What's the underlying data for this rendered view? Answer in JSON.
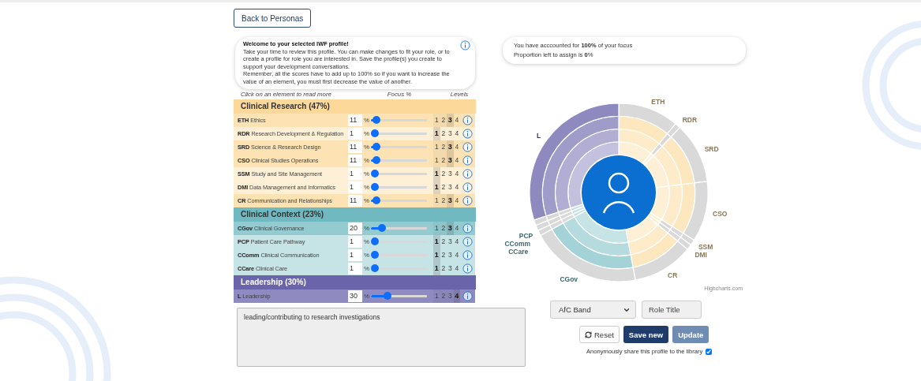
{
  "back_button": "Back to Personas",
  "intro": {
    "title": "Welcome to your selected IWF profile!",
    "paragraphs": [
      "Take your time to review this profile. You can make changes to fit your role, or to create a profile for role you are interested in. Save the profile(s) you create to support your development conversations.",
      "Remember, all the scores have to add up to 100% so if you want to increase the value of an element, you must first decrease the value of another."
    ]
  },
  "table_headers": [
    "Click on an element to read more",
    "Focus %",
    "Levels"
  ],
  "groups": [
    {
      "title": "Clinical Research (47%)",
      "color": "#fcd99a",
      "rows": [
        {
          "label": "**ETH** Ethics",
          "focus": "11",
          "unit": "%",
          "level": 0.1,
          "levels": [
            {
              "label": "1",
              "selected": false
            },
            {
              "label": "2",
              "selected": false
            },
            {
              "label": "3",
              "selected": true
            },
            {
              "label": "4",
              "selected": false
            }
          ]
        },
        {
          "label": "**RDR** Research Development & Regulation",
          "focus": "1",
          "unit": "%",
          "level": 0,
          "levels": [
            {
              "label": "1",
              "selected": true
            },
            {
              "label": "2",
              "selected": false
            },
            {
              "label": "3",
              "selected": false
            },
            {
              "label": "4",
              "selected": false
            }
          ]
        },
        {
          "label": "**SRD** Science & Research Design",
          "focus": "11",
          "unit": "%",
          "level": 0.1,
          "levels": [
            {
              "label": "1",
              "selected": false
            },
            {
              "label": "2",
              "selected": false
            },
            {
              "label": "3",
              "selected": true
            },
            {
              "label": "4",
              "selected": false
            }
          ]
        },
        {
          "label": "**CSO** Clinical Studies Operations",
          "focus": "11",
          "unit": "%",
          "level": 0.1,
          "levels": [
            {
              "label": "1",
              "selected": false
            },
            {
              "label": "2",
              "selected": false
            },
            {
              "label": "3",
              "selected": true
            },
            {
              "label": "4",
              "selected": false
            }
          ]
        },
        {
          "label": "**SSM** Study and Site Management",
          "focus": "1",
          "unit": "%",
          "level": 0,
          "levels": [
            {
              "label": "1",
              "selected": true
            },
            {
              "label": "2",
              "selected": false
            },
            {
              "label": "3",
              "selected": false
            },
            {
              "label": "4",
              "selected": false
            }
          ]
        },
        {
          "label": "**DMI** Data Management and Informatics",
          "focus": "1",
          "unit": "%",
          "level": 0,
          "levels": [
            {
              "label": "1",
              "selected": true
            },
            {
              "label": "2",
              "selected": false
            },
            {
              "label": "3",
              "selected": false
            },
            {
              "label": "4",
              "selected": false
            }
          ]
        },
        {
          "label": "**CR** Communication and Relationships",
          "focus": "11",
          "unit": "%",
          "level": 0.1,
          "levels": [
            {
              "label": "1",
              "selected": false
            },
            {
              "label": "2",
              "selected": false
            },
            {
              "label": "3",
              "selected": true
            },
            {
              "label": "4",
              "selected": false
            }
          ]
        }
      ]
    },
    {
      "title": "Clinical Context (23%)",
      "color": "#70b9c0",
      "rows": [
        {
          "label": "**CGov** Clinical Governance",
          "focus": "20",
          "unit": "%",
          "level": 0.2,
          "levels": [
            {
              "label": "1",
              "selected": false
            },
            {
              "label": "2",
              "selected": false
            },
            {
              "label": "3",
              "selected": true
            },
            {
              "label": "4",
              "selected": false
            }
          ]
        },
        {
          "label": "**PCP** Patient Care Pathway",
          "focus": "1",
          "unit": "%",
          "level": 0,
          "levels": [
            {
              "label": "1",
              "selected": true
            },
            {
              "label": "2",
              "selected": false
            },
            {
              "label": "3",
              "selected": false
            },
            {
              "label": "4",
              "selected": false
            }
          ]
        },
        {
          "label": "**CComm** Clinical Communication",
          "focus": "1",
          "unit": "%",
          "level": 0,
          "levels": [
            {
              "label": "1",
              "selected": true
            },
            {
              "label": "2",
              "selected": false
            },
            {
              "label": "3",
              "selected": false
            },
            {
              "label": "4",
              "selected": false
            }
          ]
        },
        {
          "label": "**CCare** Clinical Care",
          "focus": "1",
          "unit": "%",
          "level": 0,
          "levels": [
            {
              "label": "1",
              "selected": true
            },
            {
              "label": "2",
              "selected": false
            },
            {
              "label": "3",
              "selected": false
            },
            {
              "label": "4",
              "selected": false
            }
          ]
        }
      ]
    },
    {
      "title": "Leadership (30%)",
      "color": "#6a64ab",
      "rows": [
        {
          "label": "**L** Leadership",
          "focus": "30",
          "unit": "%",
          "level": 0.3,
          "levels": [
            {
              "label": "1",
              "selected": false
            },
            {
              "label": "2",
              "selected": false
            },
            {
              "label": "3",
              "selected": false
            },
            {
              "label": "4",
              "selected": true
            }
          ]
        }
      ]
    }
  ],
  "notes": "leading/contributing to research investigations",
  "focus_summary": [
    "You have acccounted for **100%** of your focus",
    "Proportion left to assign is **0**%"
  ],
  "chart": {
    "labels": [
      "ETH",
      "RDR",
      "SRD",
      "CSO",
      "SSM",
      "DMI",
      "CR",
      "CGov",
      "PCP",
      "CComm",
      "CCare",
      "L"
    ],
    "credit": "Highcharts.com"
  },
  "band_select": "AfC Band",
  "role_title": {
    "placeholder": "Role Title"
  },
  "buttons": [
    {
      "label": "Reset",
      "kind": "reset",
      "disabled": false
    },
    {
      "label": "Save new",
      "kind": "primary",
      "disabled": false
    },
    {
      "label": "Update",
      "kind": "primary",
      "disabled": true
    }
  ],
  "share": {
    "label": "Anonymously share this profile to the library",
    "checked": true
  }
}
